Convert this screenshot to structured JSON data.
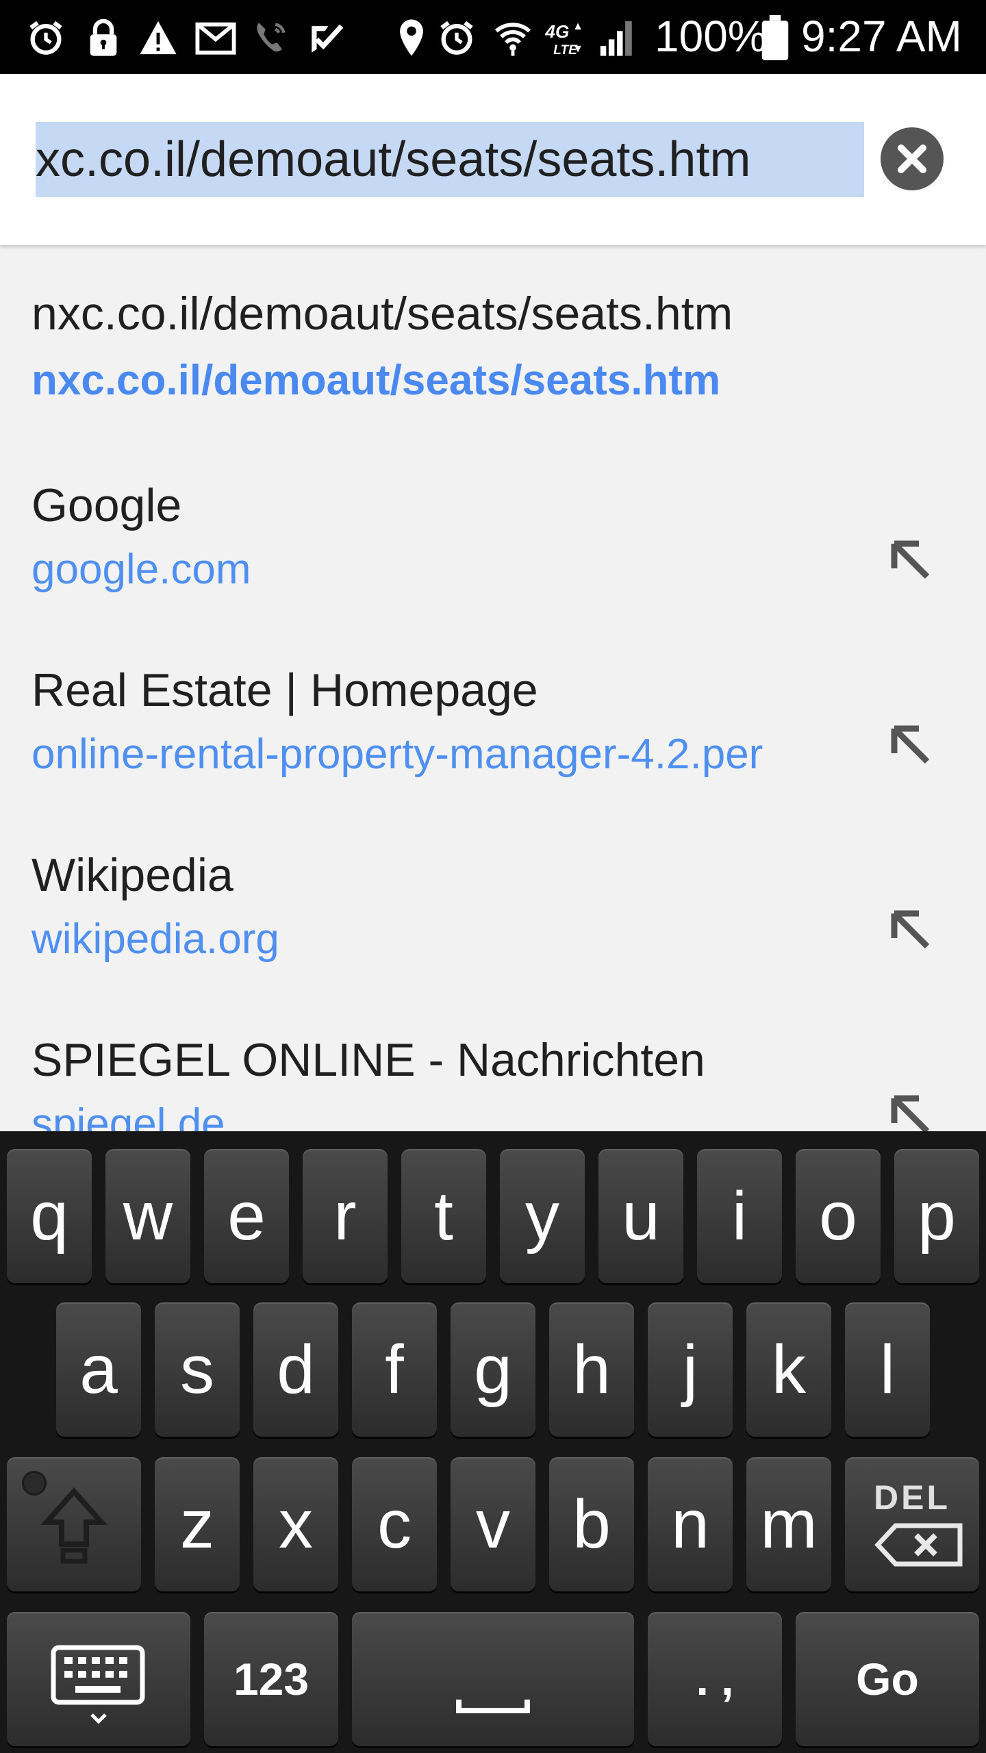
{
  "status_bar": {
    "battery_percent": "100%",
    "time": "9:27 AM",
    "network_label": "4G LTE",
    "icons": [
      "alarm-icon",
      "lock-icon",
      "warning-icon",
      "gmail-icon",
      "wifi-calling-icon",
      "check-icon",
      "location-icon",
      "alarm-icon",
      "wifi-icon",
      "lte-icon",
      "signal-icon",
      "battery-icon"
    ]
  },
  "address_bar": {
    "url": "xc.co.il/demoaut/seats/seats.htm",
    "clear_icon": "clear-icon"
  },
  "suggestions": [
    {
      "title": "nxc.co.il/demoaut/seats/seats.htm",
      "url": "nxc.co.il/demoaut/seats/seats.htm",
      "bold_url": true,
      "has_arrow": false
    },
    {
      "title": "Google",
      "url": "google.com",
      "bold_url": false,
      "has_arrow": true
    },
    {
      "title": "Real Estate | Homepage",
      "url": "online-rental-property-manager-4.2.per",
      "bold_url": false,
      "has_arrow": true
    },
    {
      "title": "Wikipedia",
      "url": "wikipedia.org",
      "bold_url": false,
      "has_arrow": true
    },
    {
      "title": "SPIEGEL ONLINE - Nachrichten",
      "url": "spiegel.de",
      "bold_url": false,
      "has_arrow": true
    }
  ],
  "keyboard": {
    "row1": [
      "q",
      "w",
      "e",
      "r",
      "t",
      "y",
      "u",
      "i",
      "o",
      "p"
    ],
    "row2": [
      "a",
      "s",
      "d",
      "f",
      "g",
      "h",
      "j",
      "k",
      "l"
    ],
    "row3": [
      "z",
      "x",
      "c",
      "v",
      "b",
      "n",
      "m"
    ],
    "del_label": "DEL",
    "numbers_label": "123",
    "punctuation_label": ". ,",
    "go_label": "Go"
  },
  "colors": {
    "status_bar_bg": "#000000",
    "url_highlight": "#c5d9f5",
    "link_blue": "#4f8ff0",
    "suggestion_bg": "#f2f2f2",
    "keyboard_bg": "#171717"
  }
}
